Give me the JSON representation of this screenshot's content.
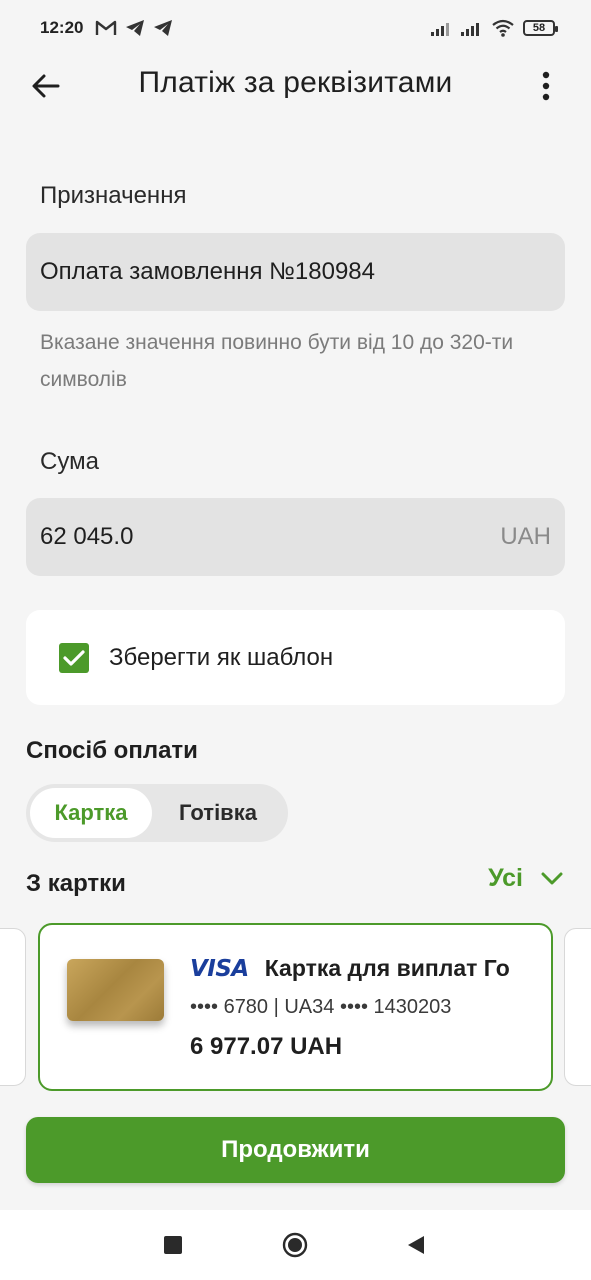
{
  "status_bar": {
    "time": "12:20",
    "notification_icons": [
      "gmail-icon",
      "telegram-icon",
      "telegram-icon"
    ],
    "battery_level": "58"
  },
  "app_bar": {
    "title": "Платіж за реквізитами"
  },
  "form": {
    "purpose_label": "Призначення",
    "purpose_value": "Оплата замовлення №180984",
    "purpose_hint": "Вказане значення повинно бути від 10 до 320-ти символів",
    "amount_label": "Сума",
    "amount_value": "62 045.0",
    "amount_currency": "UAH",
    "save_template_label": "Зберегти як шаблон",
    "save_template_checked": true
  },
  "payment_method": {
    "title": "Спосіб оплати",
    "options": [
      "Картка",
      "Готівка"
    ],
    "selected": "Картка"
  },
  "from_card": {
    "title": "З картки",
    "all_label": "Усі",
    "card": {
      "brand": "VISA",
      "name": "Картка для виплат Го",
      "number": "•••• 6780 | UA34 •••• 1430203",
      "balance": "6 977.07 UAH"
    }
  },
  "continue_label": "Продовжити",
  "colors": {
    "accent": "#4c9a2a",
    "background": "#f5f5f5",
    "input_background": "#e3e3e3",
    "visa_blue": "#1a3e9c"
  }
}
